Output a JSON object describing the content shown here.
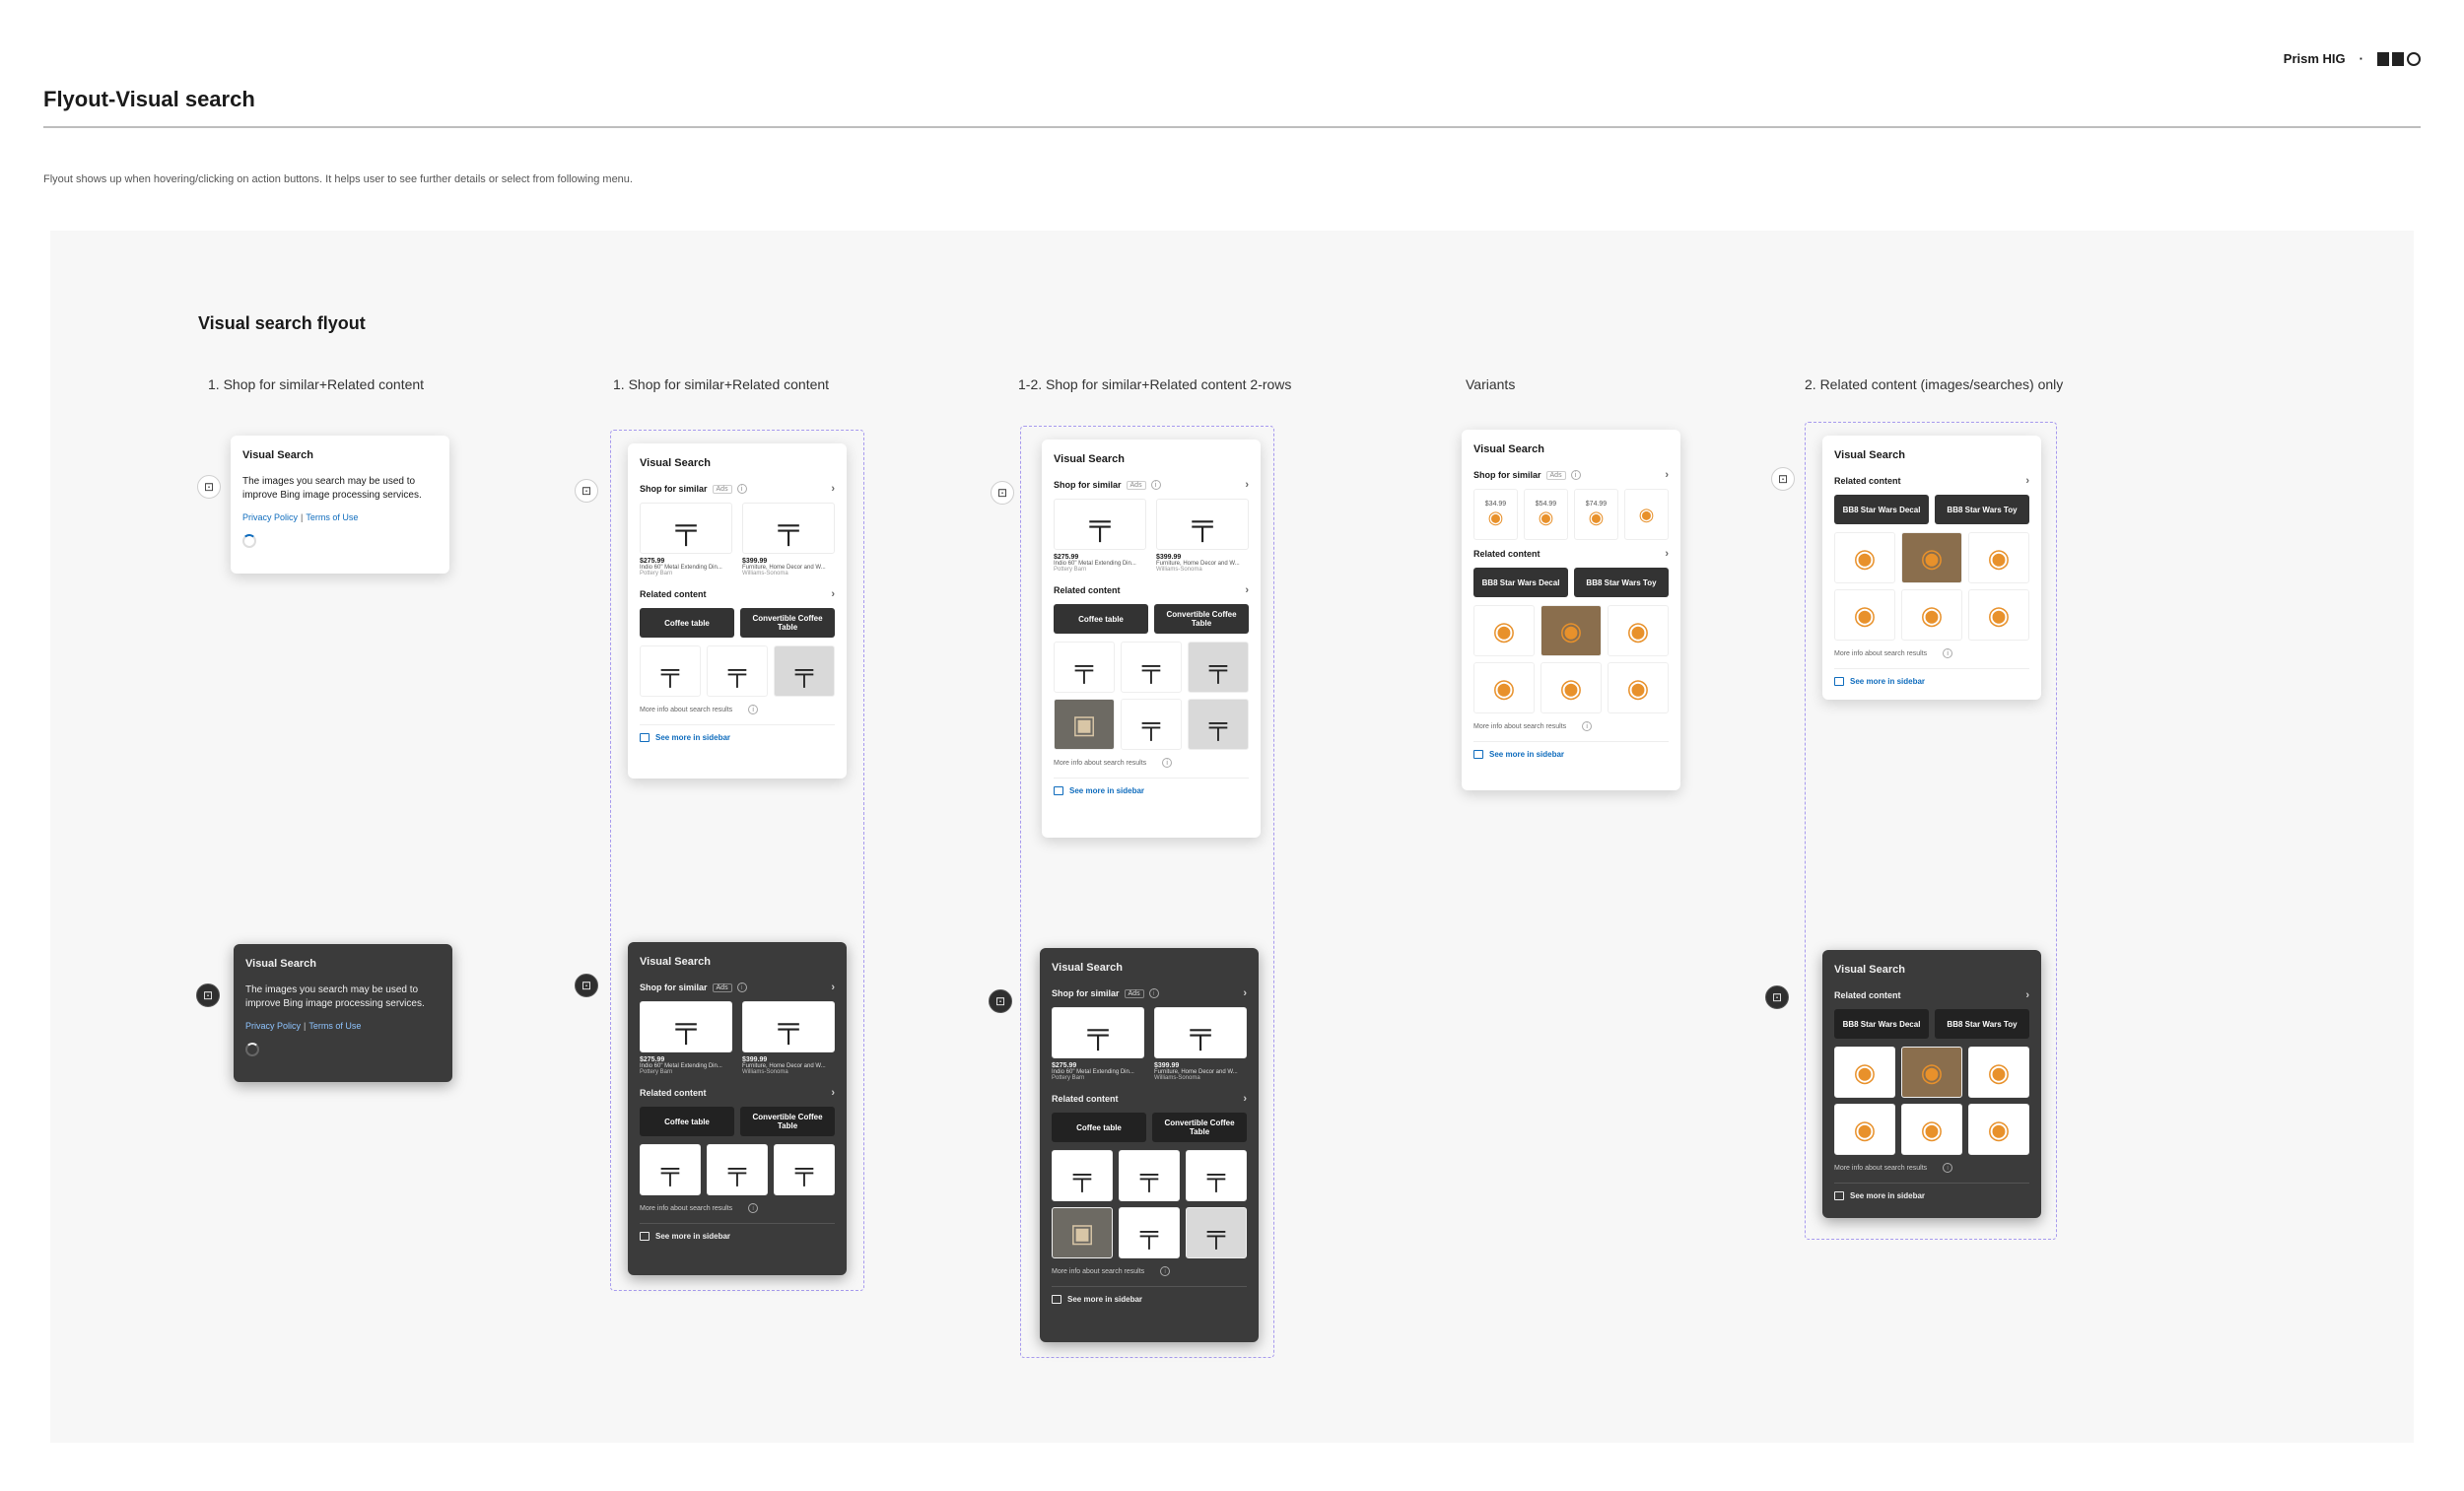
{
  "header": {
    "brand": "Prism HIG",
    "brand_dot": "·",
    "title": "Flyout-Visual search",
    "description": "Flyout shows up when hovering/clicking on action buttons. It helps user to see further details or select from following menu."
  },
  "section": {
    "title": "Visual search flyout",
    "columns": [
      "1. Shop for similar+Related content",
      "1. Shop for similar+Related content",
      "1-2. Shop for similar+Related content  2-rows",
      "Variants",
      "2. Related content (images/searches) only"
    ]
  },
  "flyout": {
    "title": "Visual Search",
    "consent_text": "The images you search may be used to improve Bing image processing services.",
    "privacy_link": "Privacy Policy",
    "link_separator": "|",
    "terms_link": "Terms of Use",
    "shop_label": "Shop for similar",
    "ads_label": "Ads",
    "info_glyph": "i",
    "chevron_glyph": "›",
    "related_label": "Related content",
    "more_info": "More info about search results",
    "see_more": "See more in sidebar",
    "products": [
      {
        "price": "$275.99",
        "name": "Indio 60\" Metal Extending Din...",
        "store": "Pottery Barn"
      },
      {
        "price": "$399.99",
        "name": "Furniture, Home Decor and W...",
        "store": "Williams-Sonoma"
      }
    ],
    "chips": [
      "Coffee table",
      "Convertible Coffee Table"
    ],
    "variant_prices": [
      "$34.99",
      "$54.99",
      "$74.99"
    ],
    "bb8_chips": [
      "BB8 Star Wars Decal",
      "BB8 Star Wars Toy"
    ]
  },
  "icons": {
    "trigger": "visual-search-icon",
    "table_glyph": "╤",
    "room_glyph": "▣",
    "bb8_glyph": "◉"
  },
  "colors": {
    "accent": "#0f6cbd",
    "dark_surface": "#3b3b3b",
    "dashed_outline": "#a79aee",
    "canvas_bg": "#f7f7f7"
  }
}
